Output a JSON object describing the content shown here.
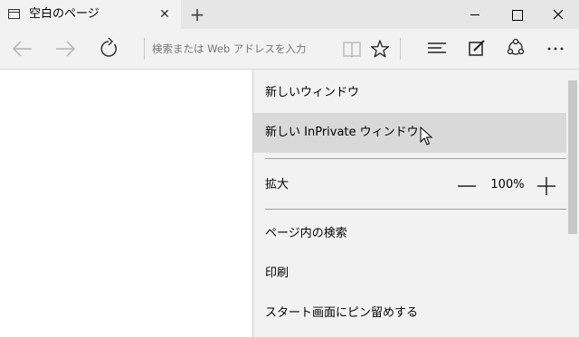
{
  "tab": {
    "title": "空白のページ",
    "close_glyph": "✕",
    "new_tab_glyph": "+"
  },
  "window": {
    "close_glyph": "✕"
  },
  "nav": {
    "back_icon": "arrow-left-icon",
    "forward_icon": "arrow-right-icon",
    "refresh_icon": "refresh-icon"
  },
  "address": {
    "placeholder": "検索または Web アドレスを入力",
    "value": ""
  },
  "toolbar": {
    "icons": [
      "reading-view-icon",
      "favorite-star-icon",
      "hub-icon",
      "web-note-icon",
      "share-icon",
      "more-icon"
    ],
    "more_glyph": "···"
  },
  "menu": {
    "new_window": "新しいウィンドウ",
    "new_inprivate_window": "新しい InPrivate ウィンドウ",
    "zoom_label": "拡大",
    "zoom_value": "100%",
    "find_on_page": "ページ内の検索",
    "print": "印刷",
    "pin_to_start": "スタート画面にピン留めする"
  },
  "colors": {
    "titlebar": "#e6e6e6",
    "active_tab": "#f2f2f2",
    "menu_background": "#f2f2f2",
    "menu_hover": "#d9d9d9",
    "page": "#ffffff"
  }
}
